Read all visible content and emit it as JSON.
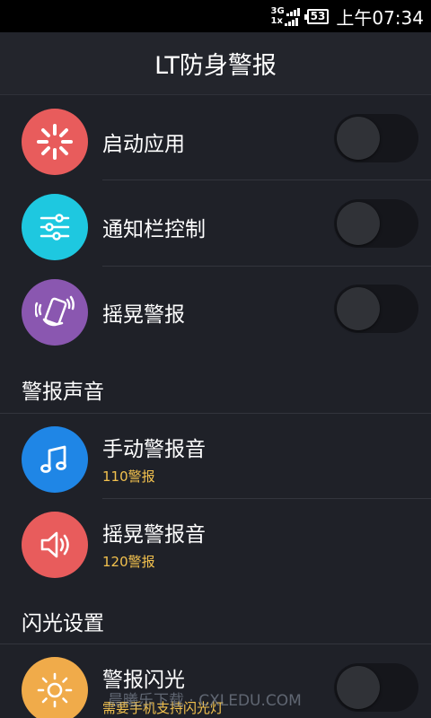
{
  "status_bar": {
    "network_top": "3G",
    "network_bottom": "1x",
    "battery": "53",
    "time": "上午07:34"
  },
  "header": {
    "title": "LT防身警报"
  },
  "toggle_items": [
    {
      "label": "启动应用",
      "icon": "sparkle-icon",
      "color": "#e85c5c",
      "enabled": false
    },
    {
      "label": "通知栏控制",
      "icon": "sliders-icon",
      "color": "#1ec8e0",
      "enabled": false
    },
    {
      "label": "摇晃警报",
      "icon": "shaking-phone-icon",
      "color": "#8a57b0",
      "enabled": false
    }
  ],
  "sections": {
    "sound": "警报声音",
    "flash": "闪光设置"
  },
  "sound_items": [
    {
      "label": "手动警报音",
      "value": "110警报",
      "icon": "music-note-icon",
      "color": "#1f86e6"
    },
    {
      "label": "摇晃警报音",
      "value": "120警报",
      "icon": "speaker-icon",
      "color": "#e85c5c"
    }
  ],
  "flash_item": {
    "label": "警报闪光",
    "desc": "需要手机支持闪光灯",
    "icon": "sun-icon",
    "color": "#f0ab4a",
    "enabled": false
  },
  "watermark": "晨曦乐下载 · CXLEDU.COM",
  "colors": {
    "background": "#1f2128",
    "accent_text": "#f2c14e"
  }
}
